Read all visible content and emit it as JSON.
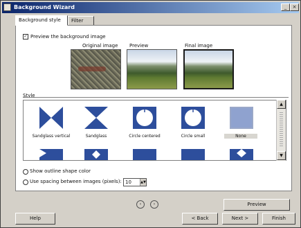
{
  "window": {
    "title": "Background Wizard",
    "buttons": {
      "minimize": "_",
      "close": "×"
    }
  },
  "tabs": [
    {
      "label": "Background style"
    },
    {
      "label": "Filter"
    }
  ],
  "options": {
    "preview_checkbox_label": "Preview the background image",
    "previews": [
      {
        "label": "Original image"
      },
      {
        "label": "Preview"
      },
      {
        "label": "Final image"
      }
    ]
  },
  "style_section": {
    "label": "Style",
    "tiles": [
      {
        "label": "Sandglass vertical"
      },
      {
        "label": "Sandglass"
      },
      {
        "label": "Circle centered"
      },
      {
        "label": "Circle small"
      },
      {
        "label": "None"
      }
    ]
  },
  "radios": [
    {
      "label": "Show outline shape color"
    },
    {
      "label": "Use spacing between images (pixels):"
    }
  ],
  "spin": {
    "value": "10"
  },
  "nav": {
    "prev": "‹",
    "next": "›"
  },
  "footer": {
    "preview_button": "Preview",
    "help": "Help",
    "back": "< Back",
    "next": "Next >",
    "finish": "Finish"
  },
  "scroll": {
    "up": "▲",
    "down": "▼"
  }
}
